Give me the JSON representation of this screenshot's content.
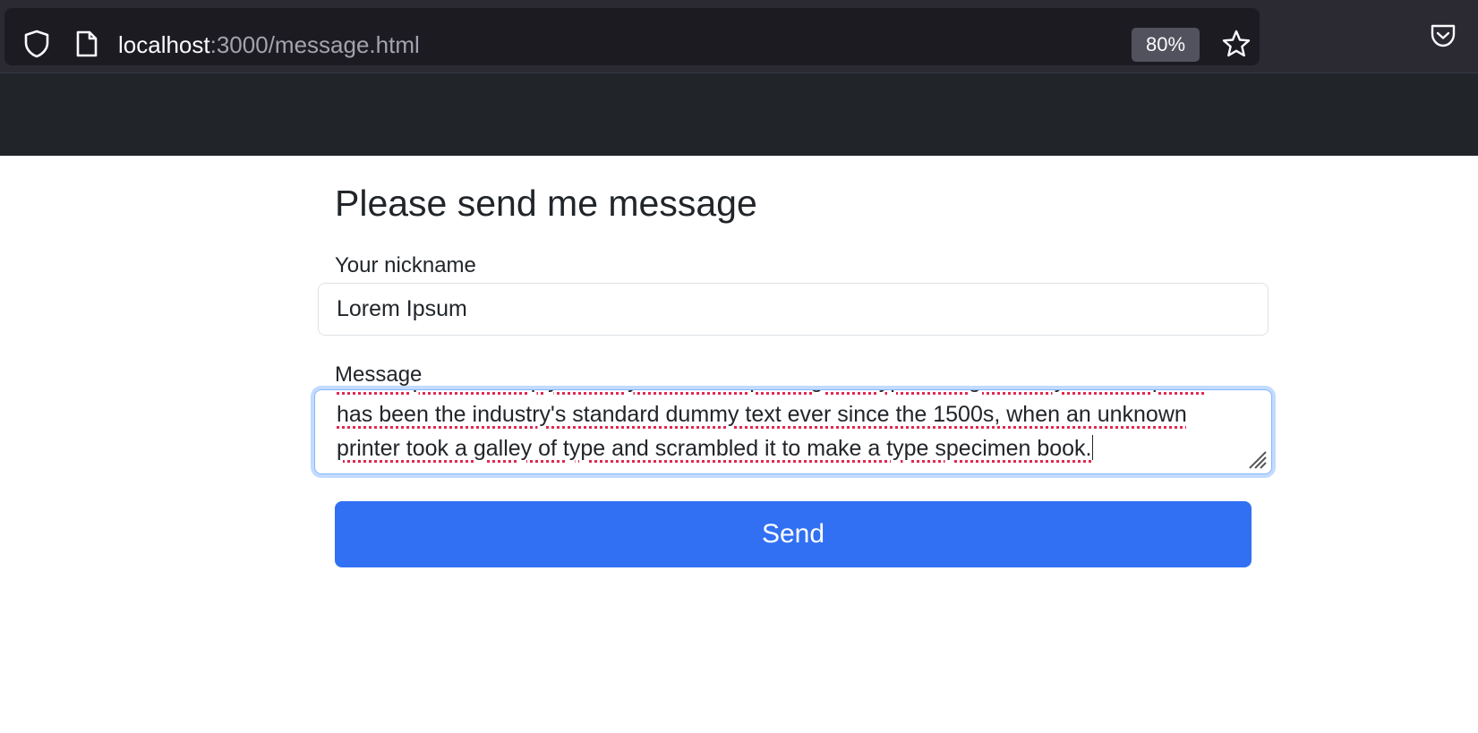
{
  "browser": {
    "url_host": "localhost",
    "url_path": ":3000/message.html",
    "zoom": "80%",
    "icons": [
      "shield-icon",
      "page-icon",
      "star-icon",
      "pocket-icon"
    ]
  },
  "page": {
    "title": "Please send me message",
    "nickname_label": "Your nickname",
    "nickname_value": "Lorem Ipsum",
    "message_label": "Message",
    "message_lines": [
      "Lorem Ipsum is simply dummy text of the printing and typesetting industry. Lorem Ipsum",
      "has been the industry's standard dummy text ever since the 1500s, when an unknown",
      "printer took a galley of type and scrambled it to make a type specimen book."
    ],
    "send_label": "Send"
  },
  "colors": {
    "toolbar": "#2b2a33",
    "url_bar": "#1c1b22",
    "navbar": "#212529",
    "primary_button": "#3170f3",
    "focus_border": "#86b7fe",
    "spellcheck": "#e22850"
  }
}
